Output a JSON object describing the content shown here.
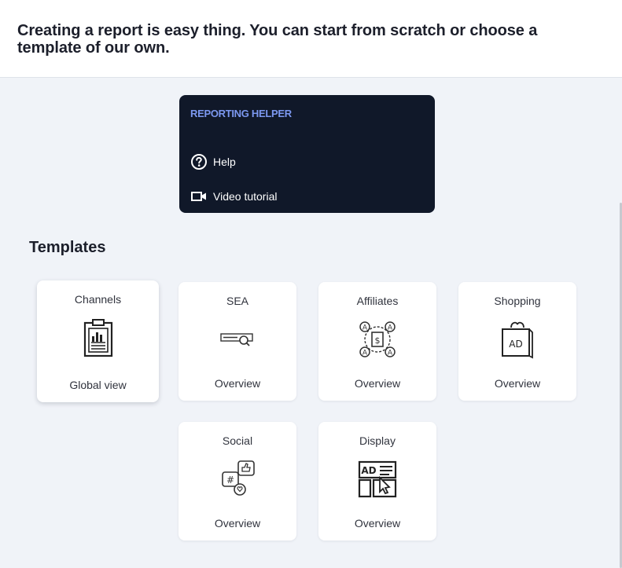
{
  "header": {
    "title": "Creating a report is easy thing. You can start from scratch or choose a template of our own."
  },
  "helper": {
    "title": "REPORTING HELPER",
    "items": [
      {
        "label": "Help",
        "icon": "help-circle-icon"
      },
      {
        "label": "Video tutorial",
        "icon": "video-camera-icon"
      }
    ]
  },
  "templates": {
    "title": "Templates",
    "cards": [
      {
        "title": "Channels",
        "subtitle": "Global view",
        "icon": "clipboard-chart-icon"
      },
      {
        "title": "SEA",
        "subtitle": "Overview",
        "icon": "search-bar-icon"
      },
      {
        "title": "Affiliates",
        "subtitle": "Overview",
        "icon": "affiliate-network-icon"
      },
      {
        "title": "Shopping",
        "subtitle": "Overview",
        "icon": "shopping-bag-ad-icon"
      },
      {
        "title": "Social",
        "subtitle": "Overview",
        "icon": "social-media-icon"
      },
      {
        "title": "Display",
        "subtitle": "Overview",
        "icon": "display-ad-icon"
      }
    ]
  },
  "colors": {
    "helper_bg": "#101829",
    "helper_title": "#7c98f0",
    "page_bg": "#f0f3f8"
  }
}
